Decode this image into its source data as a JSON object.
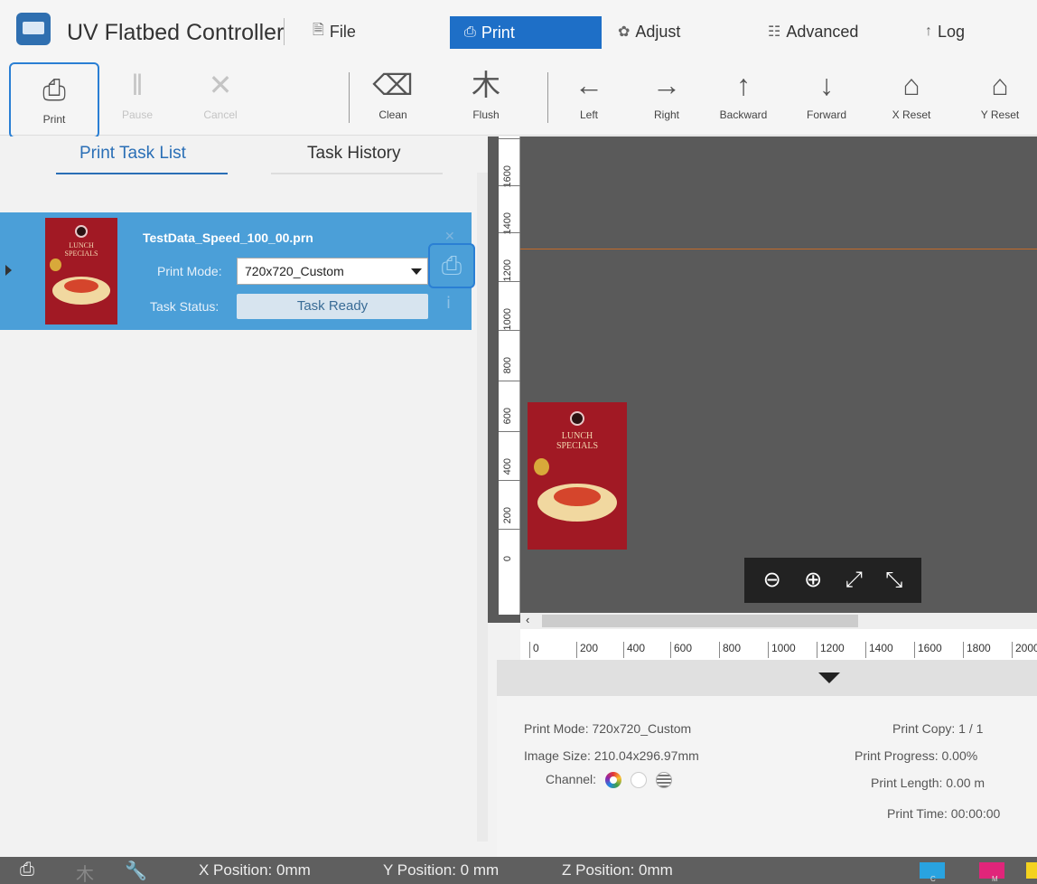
{
  "app": {
    "title": "UV Flatbed Controller"
  },
  "menu": [
    {
      "label": "File",
      "icon": "file-icon",
      "glyph": "🗎"
    },
    {
      "label": "Print",
      "icon": "printer-icon",
      "glyph": "⎙"
    },
    {
      "label": "Adjust",
      "icon": "gear-icon",
      "glyph": "✿"
    },
    {
      "label": "Advanced",
      "icon": "sliders-icon",
      "glyph": "☷"
    },
    {
      "label": "Log",
      "icon": "log-icon",
      "glyph": "↑"
    }
  ],
  "toolbar": {
    "print": "Print",
    "pause": "Pause",
    "cancel": "Cancel",
    "clean": "Clean",
    "flush": "Flush",
    "left": "Left",
    "right": "Right",
    "backward": "Backward",
    "forward": "Forward",
    "x_reset": "X Reset",
    "y_reset": "Y Reset"
  },
  "tabs": {
    "list": "Print Task List",
    "history": "Task History"
  },
  "task": {
    "file": "TestData_Speed_100_00.prn",
    "mode_label": "Print Mode:",
    "mode_value": "720x720_Custom",
    "status_label": "Task Status:",
    "status_value": "Task Ready"
  },
  "ruler": {
    "vertical": [
      "1600",
      "1400",
      "1200",
      "1000",
      "800",
      "600",
      "400",
      "200",
      "0"
    ],
    "horizontal": [
      "0",
      "200",
      "400",
      "600",
      "800",
      "1000",
      "1200",
      "1400",
      "1600",
      "1800",
      "2000"
    ]
  },
  "thumb": {
    "title_line1": "LUNCH",
    "title_line2": "SPECIALS"
  },
  "info": {
    "print_mode": "Print Mode: 720x720_Custom",
    "image_size": "Image Size: 210.04x296.97mm",
    "channel": "Channel:",
    "print_copy": "Print Copy: 1 / 1",
    "print_progress": "Print Progress: 0.00%",
    "print_length": "Print Length: 0.00 m",
    "print_time": "Print Time: 00:00:00"
  },
  "status": {
    "x": "X Position: 0mm",
    "y": "Y Position: 0 mm",
    "z": "Z Position: 0mm",
    "inks": [
      {
        "label": "C",
        "color": "#29a3e0"
      },
      {
        "label": "M",
        "color": "#e0257a"
      },
      {
        "label": "Y",
        "color": "#f4d21f"
      }
    ]
  },
  "colors": {
    "accent": "#1e6fc7",
    "task_row": "#4b9fd8",
    "canvas": "#5a5a5a"
  }
}
